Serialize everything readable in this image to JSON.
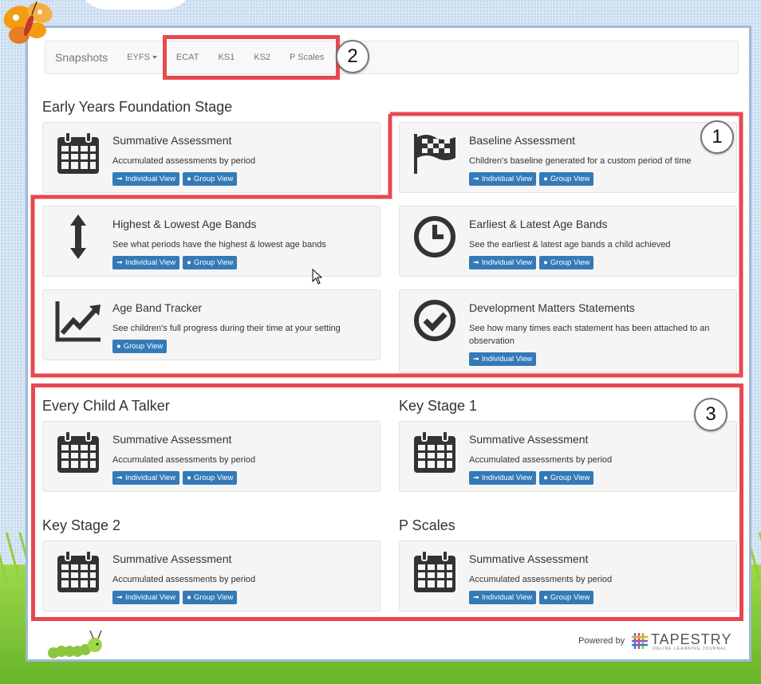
{
  "navbar": {
    "brand": "Snapshots",
    "items": [
      "EYFS",
      "ECAT",
      "KS1",
      "KS2",
      "P Scales"
    ]
  },
  "sections": {
    "eyfs": "Early Years Foundation Stage",
    "ecat": "Every Child A Talker",
    "ks1": "Key Stage 1",
    "ks2": "Key Stage 2",
    "pscales": "P Scales"
  },
  "cards": {
    "summative": {
      "title": "Summative Assessment",
      "desc": "Accumulated assessments by period"
    },
    "baseline": {
      "title": "Baseline Assessment",
      "desc": "Children's baseline generated for a custom period of time"
    },
    "highest": {
      "title": "Highest & Lowest Age Bands",
      "desc": "See what periods have the highest & lowest age bands"
    },
    "earliest": {
      "title": "Earliest & Latest Age Bands",
      "desc": "See the earliest & latest age bands a child achieved"
    },
    "tracker": {
      "title": "Age Band Tracker",
      "desc": "See children's full progress during their time at your setting"
    },
    "dms": {
      "title": "Development Matters Statements",
      "desc": "See how many times each statement has been attached to an observation"
    },
    "ecat_sum": {
      "title": "Summative Assessment",
      "desc": "Accumulated assessments by period"
    },
    "ks1_sum": {
      "title": "Summative Assessment",
      "desc": "Accumulated assessments by period"
    },
    "ks2_sum": {
      "title": "Summative Assessment",
      "desc": "Accumulated assessments by period"
    },
    "ps_sum": {
      "title": "Summative Assessment",
      "desc": "Accumulated assessments by period"
    }
  },
  "buttons": {
    "individual": "Individual View",
    "group": "Group View"
  },
  "callouts": [
    "1",
    "2",
    "3"
  ],
  "footer": {
    "powered": "Powered by",
    "logo": "TAPESTRY",
    "logo_sub": "ONLINE LEARNING JOURNAL"
  },
  "colors": {
    "accent": "#337ab7",
    "highlight": "#e84850"
  }
}
